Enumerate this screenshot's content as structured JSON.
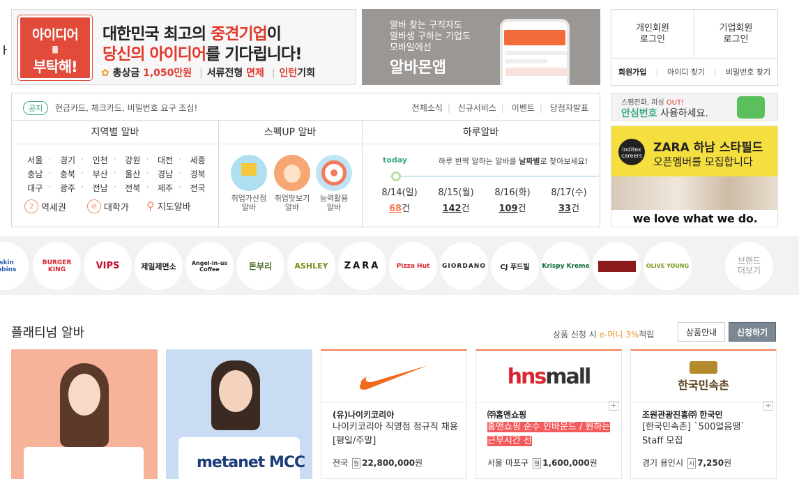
{
  "left_truncated": "ᅧ",
  "banner": {
    "logo_l1": "아이디어",
    "logo_l2": "를",
    "logo_l3": "부탁해!",
    "line1_a": "대한민국 최고의 ",
    "line1_b": "중견기업",
    "line1_c": "이",
    "line2_a": "당신의 아이디어",
    "line2_b": "를 기다립니다!",
    "prize_a": "총상금 ",
    "prize_b": "1,050만원",
    "perk1_a": "서류전형 ",
    "perk1_b": "면제",
    "perk2_a": "인턴",
    "perk2_b": "기회"
  },
  "albamon_ad": {
    "line1": "알바 찾는 구직자도",
    "line2": "알바생 구하는 기업도",
    "line3": "모바일에선",
    "title": "알바몬앱"
  },
  "login": {
    "personal": "개인회원\n로그인",
    "corporate": "기업회원\n로그인",
    "signup": "회원가입",
    "find_id": "아이디 찾기",
    "find_pw": "비밀번호 찾기"
  },
  "notice": {
    "tag": "공지",
    "text": "현금카드, 체크카드, 비밀번호 요구 조심!",
    "links": [
      "전체소식",
      "신규서비스",
      "이벤트",
      "당첨자발표"
    ]
  },
  "region": {
    "title": "지역별 알바",
    "items": [
      "서울",
      "경기",
      "인천",
      "강원",
      "대전",
      "세종",
      "충남",
      "충북",
      "부산",
      "울산",
      "경남",
      "경북",
      "대구",
      "광주",
      "전남",
      "전북",
      "제주",
      "전국"
    ],
    "extra": [
      "역세권",
      "대학가",
      "지도알바"
    ]
  },
  "spec": {
    "title": "스펙UP 알바",
    "items": [
      {
        "line1": "취업가산점",
        "line2": "알바"
      },
      {
        "line1": "취업맛보기",
        "line2": "알바"
      },
      {
        "line1": "능력활용",
        "line2": "알바"
      }
    ]
  },
  "daily": {
    "title": "하루알바",
    "today": "today",
    "desc_a": "하루 반짝 알하는 알바를 ",
    "desc_b": "날짜별",
    "desc_c": "로 찾아보세요!",
    "days": [
      {
        "date": "8/14(일)",
        "count": "68",
        "unit": "건"
      },
      {
        "date": "8/15(월)",
        "count": "142",
        "unit": "건"
      },
      {
        "date": "8/16(화)",
        "count": "109",
        "unit": "건"
      },
      {
        "date": "8/17(수)",
        "count": "33",
        "unit": "건"
      }
    ]
  },
  "safe_ad": {
    "line1_a": "스팸전화, 피싱 ",
    "line1_b": "OUT!",
    "line2_a": "안심번호",
    "line2_b": " 사용하세요."
  },
  "zara_ad": {
    "logo": "inditex\ncareers",
    "title": "ZARA 하남 스타필드",
    "subtitle": "오픈멤버를 모집합니다",
    "tagline": "we love what we do."
  },
  "brands": [
    "askin\nobbins",
    "BURGER\nKING",
    "VIPS",
    "제일제면소",
    "Angel-in-us Coffee",
    "돈부리",
    "ASHLEY",
    "ZARA",
    "Pizza Hut",
    "GIORDANO",
    "CJ 푸드빌",
    "Krispy Kreme",
    "",
    "OLIVE YOUNG"
  ],
  "brand_more": "브랜드\n더보기",
  "platinum": {
    "title": "플래티넘 알바",
    "note_a": "상품 신청 시 ",
    "note_b": "e-머니 3%",
    "note_c": "적립",
    "info_btn": "상품안내",
    "apply_btn": "신청하기",
    "photo2_logo": "metanet MCC",
    "cards": [
      {
        "logo": "NIKE",
        "company": "(유)나이키코리아",
        "job": "나이키코리아 직영점 정규직 채용[평일/주말]",
        "loc": "전국",
        "pay_tag": "월",
        "pay": "22,800,000",
        "unit": "원"
      },
      {
        "logo": "hnsmall",
        "company": "㈜홈앤쇼핑",
        "job": "홈앤쇼핑 순수 인바운드 / 원하는 근무시간 선",
        "loc": "서울 마포구",
        "pay_tag": "월",
        "pay": "1,600,000",
        "unit": "원"
      },
      {
        "logo": "한국민속촌",
        "company": "조원관광진흥㈜ 한국민",
        "job": "[한국민속촌] `500얼음땡` Staff 모집",
        "loc": "경기 용인시",
        "pay_tag": "시",
        "pay": "7,250",
        "unit": "원"
      }
    ]
  },
  "colors": {
    "accent": "#e0392b",
    "green": "#3aa882",
    "orange": "#f47a4e"
  }
}
